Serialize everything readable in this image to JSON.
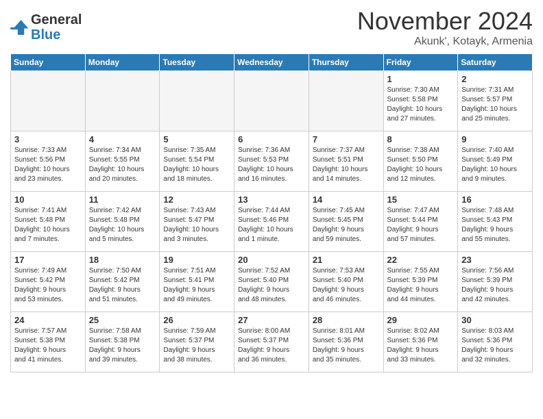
{
  "header": {
    "logo_line1": "General",
    "logo_line2": "Blue",
    "month_title": "November 2024",
    "subtitle": "Akunk', Kotayk, Armenia"
  },
  "weekdays": [
    "Sunday",
    "Monday",
    "Tuesday",
    "Wednesday",
    "Thursday",
    "Friday",
    "Saturday"
  ],
  "weeks": [
    [
      {
        "day": "",
        "info": ""
      },
      {
        "day": "",
        "info": ""
      },
      {
        "day": "",
        "info": ""
      },
      {
        "day": "",
        "info": ""
      },
      {
        "day": "",
        "info": ""
      },
      {
        "day": "1",
        "info": "Sunrise: 7:30 AM\nSunset: 5:58 PM\nDaylight: 10 hours\nand 27 minutes."
      },
      {
        "day": "2",
        "info": "Sunrise: 7:31 AM\nSunset: 5:57 PM\nDaylight: 10 hours\nand 25 minutes."
      }
    ],
    [
      {
        "day": "3",
        "info": "Sunrise: 7:33 AM\nSunset: 5:56 PM\nDaylight: 10 hours\nand 23 minutes."
      },
      {
        "day": "4",
        "info": "Sunrise: 7:34 AM\nSunset: 5:55 PM\nDaylight: 10 hours\nand 20 minutes."
      },
      {
        "day": "5",
        "info": "Sunrise: 7:35 AM\nSunset: 5:54 PM\nDaylight: 10 hours\nand 18 minutes."
      },
      {
        "day": "6",
        "info": "Sunrise: 7:36 AM\nSunset: 5:53 PM\nDaylight: 10 hours\nand 16 minutes."
      },
      {
        "day": "7",
        "info": "Sunrise: 7:37 AM\nSunset: 5:51 PM\nDaylight: 10 hours\nand 14 minutes."
      },
      {
        "day": "8",
        "info": "Sunrise: 7:38 AM\nSunset: 5:50 PM\nDaylight: 10 hours\nand 12 minutes."
      },
      {
        "day": "9",
        "info": "Sunrise: 7:40 AM\nSunset: 5:49 PM\nDaylight: 10 hours\nand 9 minutes."
      }
    ],
    [
      {
        "day": "10",
        "info": "Sunrise: 7:41 AM\nSunset: 5:48 PM\nDaylight: 10 hours\nand 7 minutes."
      },
      {
        "day": "11",
        "info": "Sunrise: 7:42 AM\nSunset: 5:48 PM\nDaylight: 10 hours\nand 5 minutes."
      },
      {
        "day": "12",
        "info": "Sunrise: 7:43 AM\nSunset: 5:47 PM\nDaylight: 10 hours\nand 3 minutes."
      },
      {
        "day": "13",
        "info": "Sunrise: 7:44 AM\nSunset: 5:46 PM\nDaylight: 10 hours\nand 1 minute."
      },
      {
        "day": "14",
        "info": "Sunrise: 7:45 AM\nSunset: 5:45 PM\nDaylight: 9 hours\nand 59 minutes."
      },
      {
        "day": "15",
        "info": "Sunrise: 7:47 AM\nSunset: 5:44 PM\nDaylight: 9 hours\nand 57 minutes."
      },
      {
        "day": "16",
        "info": "Sunrise: 7:48 AM\nSunset: 5:43 PM\nDaylight: 9 hours\nand 55 minutes."
      }
    ],
    [
      {
        "day": "17",
        "info": "Sunrise: 7:49 AM\nSunset: 5:42 PM\nDaylight: 9 hours\nand 53 minutes."
      },
      {
        "day": "18",
        "info": "Sunrise: 7:50 AM\nSunset: 5:42 PM\nDaylight: 9 hours\nand 51 minutes."
      },
      {
        "day": "19",
        "info": "Sunrise: 7:51 AM\nSunset: 5:41 PM\nDaylight: 9 hours\nand 49 minutes."
      },
      {
        "day": "20",
        "info": "Sunrise: 7:52 AM\nSunset: 5:40 PM\nDaylight: 9 hours\nand 48 minutes."
      },
      {
        "day": "21",
        "info": "Sunrise: 7:53 AM\nSunset: 5:40 PM\nDaylight: 9 hours\nand 46 minutes."
      },
      {
        "day": "22",
        "info": "Sunrise: 7:55 AM\nSunset: 5:39 PM\nDaylight: 9 hours\nand 44 minutes."
      },
      {
        "day": "23",
        "info": "Sunrise: 7:56 AM\nSunset: 5:39 PM\nDaylight: 9 hours\nand 42 minutes."
      }
    ],
    [
      {
        "day": "24",
        "info": "Sunrise: 7:57 AM\nSunset: 5:38 PM\nDaylight: 9 hours\nand 41 minutes."
      },
      {
        "day": "25",
        "info": "Sunrise: 7:58 AM\nSunset: 5:38 PM\nDaylight: 9 hours\nand 39 minutes."
      },
      {
        "day": "26",
        "info": "Sunrise: 7:59 AM\nSunset: 5:37 PM\nDaylight: 9 hours\nand 38 minutes."
      },
      {
        "day": "27",
        "info": "Sunrise: 8:00 AM\nSunset: 5:37 PM\nDaylight: 9 hours\nand 36 minutes."
      },
      {
        "day": "28",
        "info": "Sunrise: 8:01 AM\nSunset: 5:36 PM\nDaylight: 9 hours\nand 35 minutes."
      },
      {
        "day": "29",
        "info": "Sunrise: 8:02 AM\nSunset: 5:36 PM\nDaylight: 9 hours\nand 33 minutes."
      },
      {
        "day": "30",
        "info": "Sunrise: 8:03 AM\nSunset: 5:36 PM\nDaylight: 9 hours\nand 32 minutes."
      }
    ]
  ]
}
